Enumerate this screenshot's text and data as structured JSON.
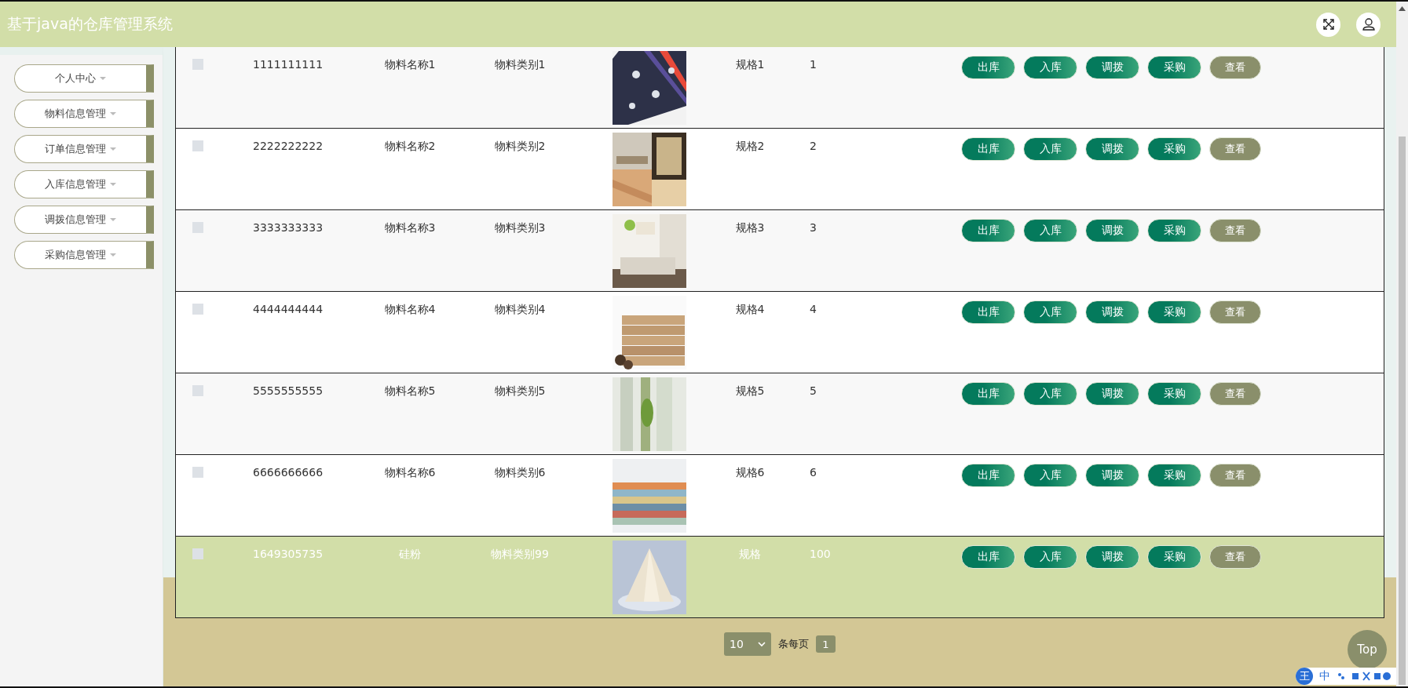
{
  "header": {
    "title": "基于java的仓库管理系统"
  },
  "sidebar": {
    "items": [
      {
        "label": "个人中心"
      },
      {
        "label": "物料信息管理"
      },
      {
        "label": "订单信息管理"
      },
      {
        "label": "入库信息管理"
      },
      {
        "label": "调拨信息管理"
      },
      {
        "label": "采购信息管理"
      }
    ]
  },
  "table": {
    "rows": [
      {
        "checked": false,
        "hovered": false,
        "code": "1111111111",
        "name": "物料名称1",
        "category": "物料类别1",
        "image": {
          "kind": "picture"
        },
        "spec": "规格1",
        "quantity": "1",
        "actions": [
          {
            "label": "出库",
            "kind": "primary"
          },
          {
            "label": "入库",
            "kind": "primary"
          },
          {
            "label": "调拨",
            "kind": "primary"
          },
          {
            "label": "采购",
            "kind": "primary"
          },
          {
            "label": "查看",
            "kind": "secondary"
          }
        ]
      },
      {
        "checked": false,
        "hovered": false,
        "code": "2222222222",
        "name": "物料名称2",
        "category": "物料类别2",
        "image": {
          "kind": "picture"
        },
        "spec": "规格2",
        "quantity": "2",
        "actions": [
          {
            "label": "出库",
            "kind": "primary"
          },
          {
            "label": "入库",
            "kind": "primary"
          },
          {
            "label": "调拨",
            "kind": "primary"
          },
          {
            "label": "采购",
            "kind": "primary"
          },
          {
            "label": "查看",
            "kind": "secondary"
          }
        ]
      },
      {
        "checked": false,
        "hovered": false,
        "code": "3333333333",
        "name": "物料名称3",
        "category": "物料类别3",
        "image": {
          "kind": "picture"
        },
        "spec": "规格3",
        "quantity": "3",
        "actions": [
          {
            "label": "出库",
            "kind": "primary"
          },
          {
            "label": "入库",
            "kind": "primary"
          },
          {
            "label": "调拨",
            "kind": "primary"
          },
          {
            "label": "采购",
            "kind": "primary"
          },
          {
            "label": "查看",
            "kind": "secondary"
          }
        ]
      },
      {
        "checked": false,
        "hovered": false,
        "code": "4444444444",
        "name": "物料名称4",
        "category": "物料类别4",
        "image": {
          "kind": "picture"
        },
        "spec": "规格4",
        "quantity": "4",
        "actions": [
          {
            "label": "出库",
            "kind": "primary"
          },
          {
            "label": "入库",
            "kind": "primary"
          },
          {
            "label": "调拨",
            "kind": "primary"
          },
          {
            "label": "采购",
            "kind": "primary"
          },
          {
            "label": "查看",
            "kind": "secondary"
          }
        ]
      },
      {
        "checked": false,
        "hovered": false,
        "code": "5555555555",
        "name": "物料名称5",
        "category": "物料类别5",
        "image": {
          "kind": "picture"
        },
        "spec": "规格5",
        "quantity": "5",
        "actions": [
          {
            "label": "出库",
            "kind": "primary"
          },
          {
            "label": "入库",
            "kind": "primary"
          },
          {
            "label": "调拨",
            "kind": "primary"
          },
          {
            "label": "采购",
            "kind": "primary"
          },
          {
            "label": "查看",
            "kind": "secondary"
          }
        ]
      },
      {
        "checked": false,
        "hovered": false,
        "code": "6666666666",
        "name": "物料名称6",
        "category": "物料类别6",
        "image": {
          "kind": "picture"
        },
        "spec": "规格6",
        "quantity": "6",
        "actions": [
          {
            "label": "出库",
            "kind": "primary"
          },
          {
            "label": "入库",
            "kind": "primary"
          },
          {
            "label": "调拨",
            "kind": "primary"
          },
          {
            "label": "采购",
            "kind": "primary"
          },
          {
            "label": "查看",
            "kind": "secondary"
          }
        ]
      },
      {
        "checked": false,
        "hovered": true,
        "code": "1649305735",
        "name": "硅粉",
        "category": "物料类别99",
        "image": {
          "kind": "picture"
        },
        "spec": "规格",
        "quantity": "100",
        "actions": [
          {
            "label": "出库",
            "kind": "primary"
          },
          {
            "label": "入库",
            "kind": "primary"
          },
          {
            "label": "调拨",
            "kind": "primary"
          },
          {
            "label": "采购",
            "kind": "primary"
          },
          {
            "label": "查看",
            "kind": "secondary"
          }
        ]
      }
    ]
  },
  "pagination": {
    "page_size": "10",
    "per_page_label": "条每页",
    "pages": [
      {
        "label": "1",
        "selected": true
      }
    ]
  },
  "back_to_top": "Top",
  "ime_toolbar": {
    "items": [
      "王",
      "中"
    ]
  }
}
